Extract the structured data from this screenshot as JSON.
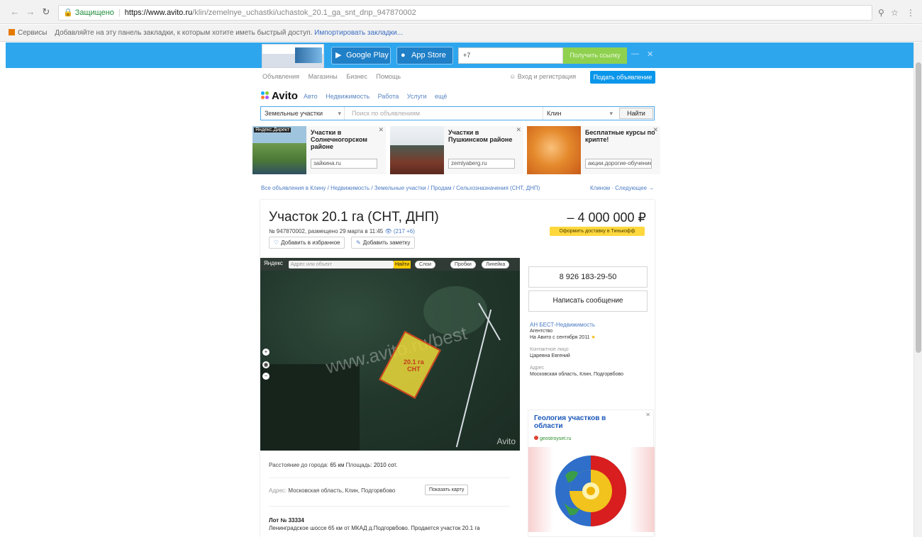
{
  "browser": {
    "secure_label": "Защищено",
    "url_host": "https://www.avito.ru",
    "url_path": "/klin/zemelnye_uchastki/uchastok_20.1_ga_snt_dnp_947870002",
    "bookmarks_label": "Сервисы",
    "bookmarks_hint": "Добавляйте на эту панель закладки, к которым хотите иметь быстрый доступ.",
    "bookmarks_import": "Импортировать закладки..."
  },
  "banner": {
    "google_play_label": "Google Play",
    "app_store_label": "App Store",
    "phone_prefix": "+7",
    "submit_label": "Получить ссылку"
  },
  "topnav": {
    "links": [
      "Объявления",
      "Магазины",
      "Бизнес",
      "Помощь"
    ],
    "login_label": "Вход и регистрация",
    "post_label": "Подать объявление"
  },
  "logo": {
    "text": "Avito"
  },
  "categories": [
    "Авто",
    "Недвижимость",
    "Работа",
    "Услуги",
    "ещё"
  ],
  "search": {
    "category": "Земельные участки",
    "placeholder": "Поиск по объявлениям",
    "city": "Клин",
    "button": "Найти"
  },
  "ads": [
    {
      "tag": "Яндекс.Директ",
      "title": "Участки в Солнечногорском районе",
      "button": "зайкина.ru"
    },
    {
      "tag": "",
      "title": "Участки в Пушкинском районе",
      "button": "zemlyaberg.ru"
    },
    {
      "tag": "",
      "title": "Бесплатные курсы по крипте!",
      "button": "акции.дорогие-обучение.ru"
    }
  ],
  "breadcrumbs": "Все объявления в Клину / Недвижимость / Земельные участки / Продам / Сельхозназначения (СНТ, ДНП)",
  "breadcrumb_right": "Клином · Следующее →",
  "listing": {
    "title": "Участок 20.1 га (СНТ, ДНП)",
    "price": "4 000 000 ₽",
    "meta": "№ 947870002, размещено 29 марта в 11:45",
    "views": "(217 +6)",
    "pay_button": "Оформить доставку в Тинькофф",
    "favorite_button": "Добавить в избранное",
    "note_button": "Добавить заметку"
  },
  "map": {
    "logo": "Яндекс",
    "search_placeholder": "Адрес или объект",
    "find_label": "Найти",
    "tools": [
      "Слои",
      "Пробки",
      "Линейка"
    ],
    "plot_label": "20.1 га\nСНТ",
    "watermark": "www.avito.ru/best",
    "brand": "Avito"
  },
  "contact": {
    "phone": "8 926 183-29-50",
    "message": "Написать сообщение",
    "seller_name": "АН БЕСТ-Недвижимость",
    "seller_type": "Агентство",
    "seller_since": "На Авито с сентября 2011",
    "contact_label": "Контактное лицо",
    "contact_name": "Царевна Евгений",
    "address_label": "Адрес",
    "address": "Московская область, Клин, Подгорвбово"
  },
  "side_ad": {
    "title": "Геология участков в области",
    "domain": "geostroyset.ru"
  },
  "details": {
    "distance_label": "Расстояние до города:",
    "distance": "65 км",
    "area_label": "Площадь:",
    "area": "2010 сот.",
    "address_label": "Адрес:",
    "address": "Московская область, Клин, Подгорвбово",
    "show_map": "Показать карту",
    "desc_title": "Лот № 33334",
    "desc": "Ленинградское шоссе 65 км от МКАД д.Подгорвбово. Продается участок 20.1 га"
  }
}
